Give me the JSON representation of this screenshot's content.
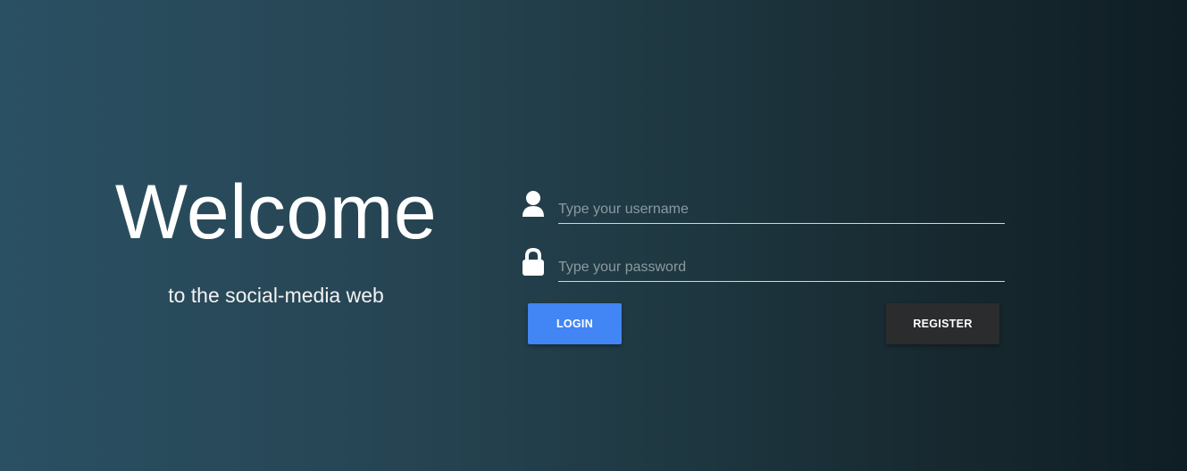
{
  "welcome": {
    "title": "Welcome",
    "subtitle": "to the social-media web"
  },
  "form": {
    "username": {
      "icon": "user-icon",
      "placeholder": "Type your username",
      "value": ""
    },
    "password": {
      "icon": "lock-icon",
      "placeholder": "Type your password",
      "value": ""
    },
    "login_label": "LOGIN",
    "register_label": "REGISTER"
  },
  "colors": {
    "login_button": "#4285f4",
    "register_button": "#2a2c2d",
    "background_left": "#2a5063",
    "background_right": "#0e1e24"
  }
}
